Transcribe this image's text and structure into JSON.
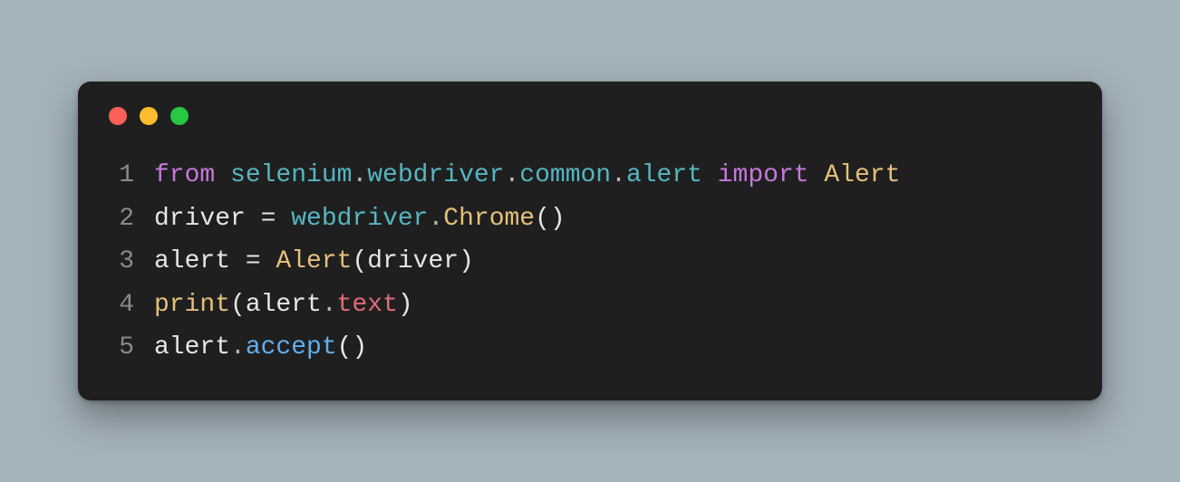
{
  "window": {
    "traffic_lights": [
      "close",
      "minimize",
      "zoom"
    ],
    "colors": {
      "background": "#1f1f1f",
      "page_background": "#a4b2ba",
      "keyword": "#c678dd",
      "module": "#55b6c2",
      "class": "#e5c07b",
      "func": "#61afef",
      "ident": "#e6e6e6",
      "attr": "#e06c75",
      "line_number": "#8a8a8a"
    }
  },
  "code": {
    "language": "python",
    "lines": [
      {
        "n": "1",
        "tokens": [
          {
            "t": "from ",
            "c": "tok-keyword"
          },
          {
            "t": "selenium",
            "c": "tok-module"
          },
          {
            "t": ".",
            "c": "tok-dot"
          },
          {
            "t": "webdriver",
            "c": "tok-module"
          },
          {
            "t": ".",
            "c": "tok-dot"
          },
          {
            "t": "common",
            "c": "tok-module"
          },
          {
            "t": ".",
            "c": "tok-dot"
          },
          {
            "t": "alert",
            "c": "tok-module"
          },
          {
            "t": " import ",
            "c": "tok-keyword"
          },
          {
            "t": "Alert",
            "c": "tok-class"
          }
        ]
      },
      {
        "n": "2",
        "tokens": [
          {
            "t": "driver",
            "c": "tok-ident"
          },
          {
            "t": " = ",
            "c": "tok-punct"
          },
          {
            "t": "webdriver",
            "c": "tok-module"
          },
          {
            "t": ".",
            "c": "tok-dot"
          },
          {
            "t": "Chrome",
            "c": "tok-class"
          },
          {
            "t": "()",
            "c": "tok-punct"
          }
        ]
      },
      {
        "n": "3",
        "tokens": [
          {
            "t": "alert",
            "c": "tok-ident"
          },
          {
            "t": " = ",
            "c": "tok-punct"
          },
          {
            "t": "Alert",
            "c": "tok-class"
          },
          {
            "t": "(",
            "c": "tok-punct"
          },
          {
            "t": "driver",
            "c": "tok-ident"
          },
          {
            "t": ")",
            "c": "tok-punct"
          }
        ]
      },
      {
        "n": "4",
        "tokens": [
          {
            "t": "print",
            "c": "tok-builtin"
          },
          {
            "t": "(",
            "c": "tok-punct"
          },
          {
            "t": "alert",
            "c": "tok-ident"
          },
          {
            "t": ".",
            "c": "tok-dot"
          },
          {
            "t": "text",
            "c": "tok-attr"
          },
          {
            "t": ")",
            "c": "tok-punct"
          }
        ]
      },
      {
        "n": "5",
        "tokens": [
          {
            "t": "alert",
            "c": "tok-ident"
          },
          {
            "t": ".",
            "c": "tok-dot"
          },
          {
            "t": "accept",
            "c": "tok-func"
          },
          {
            "t": "()",
            "c": "tok-punct"
          }
        ]
      }
    ]
  }
}
